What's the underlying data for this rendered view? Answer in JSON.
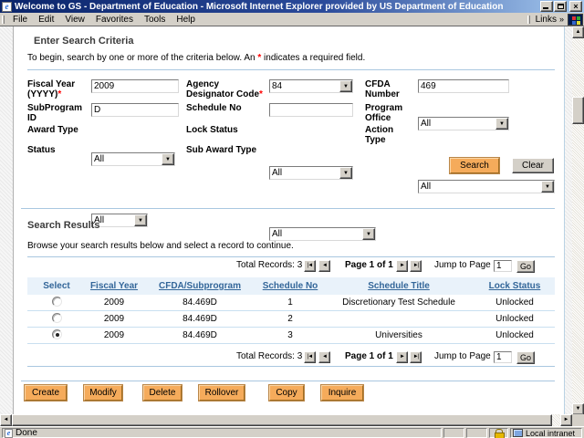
{
  "window": {
    "title": "Welcome to GS - Department of Education - Microsoft Internet Explorer provided by US Department of Education",
    "menu": [
      "File",
      "Edit",
      "View",
      "Favorites",
      "Tools",
      "Help"
    ],
    "links_label": "Links",
    "links_chevron": "»"
  },
  "icons": {
    "dropdown": "▼",
    "scroll_up": "▲",
    "scroll_down": "▼",
    "scroll_left": "◄",
    "scroll_right": "►",
    "pager_first": "|◄",
    "pager_prev": "◄",
    "pager_next": "►",
    "pager_last": "►|",
    "close": "×"
  },
  "colors": {
    "titlebar_left": "#0a246a",
    "titlebar_right": "#a6caf0",
    "chrome_gray": "#d4d0c8",
    "accent_orange": "#f5ab5b",
    "header_link_blue": "#336699",
    "rule_blue": "#a9c7e0",
    "table_header_bg": "#e9f2fa",
    "required_red": "#ff0000"
  },
  "criteria": {
    "heading": "Enter Search Criteria",
    "intro_before": "To begin, search by one or more of the criteria below. An ",
    "required_marker": "*",
    "intro_after": " indicates a required field.",
    "fields": {
      "fiscal_year": {
        "label": "Fiscal Year (YYYY)",
        "value": "2009"
      },
      "agency_designator_code": {
        "label": "Agency Designator Code",
        "value": "84"
      },
      "cfda_number": {
        "label": "CFDA Number",
        "value": "469"
      },
      "subprogram_id": {
        "label": "SubProgram ID",
        "value": "D"
      },
      "schedule_no": {
        "label": "Schedule No",
        "value": ""
      },
      "program_office": {
        "label": "Program Office",
        "value": "All"
      },
      "award_type": {
        "label": "Award Type",
        "value": "All"
      },
      "lock_status": {
        "label": "Lock Status",
        "value": "All"
      },
      "action_type": {
        "label": "Action Type",
        "value": "All"
      },
      "status": {
        "label": "Status",
        "value": "All"
      },
      "sub_award_type": {
        "label": "Sub Award Type",
        "value": "All"
      }
    },
    "buttons": {
      "search": "Search",
      "clear": "Clear"
    }
  },
  "results": {
    "heading": "Search Results",
    "intro": "Browse your search results below and select a record to continue.",
    "pagination": {
      "total_label": "Total Records:",
      "total": "3",
      "page_label": "Page 1 of 1",
      "jump_label": "Jump to Page",
      "jump_value": "1",
      "go": "Go"
    },
    "table": {
      "headers": [
        "Select",
        "Fiscal Year",
        "CFDA/Subprogram",
        "Schedule No",
        "Schedule Title",
        "Lock Status"
      ],
      "rows": [
        {
          "selected": false,
          "fiscal_year": "2009",
          "cfda_subprogram": "84.469D",
          "schedule_no": "1",
          "schedule_title": "Discretionary Test Schedule",
          "lock_status": "Unlocked"
        },
        {
          "selected": false,
          "fiscal_year": "2009",
          "cfda_subprogram": "84.469D",
          "schedule_no": "2",
          "schedule_title": "",
          "lock_status": "Unlocked"
        },
        {
          "selected": true,
          "fiscal_year": "2009",
          "cfda_subprogram": "84.469D",
          "schedule_no": "3",
          "schedule_title": "Universities",
          "lock_status": "Unlocked"
        }
      ]
    },
    "actions": [
      "Create",
      "Modify",
      "Delete",
      "Rollover",
      "Copy",
      "Inquire"
    ]
  },
  "statusbar": {
    "status": "Done",
    "zone": "Local intranet"
  }
}
